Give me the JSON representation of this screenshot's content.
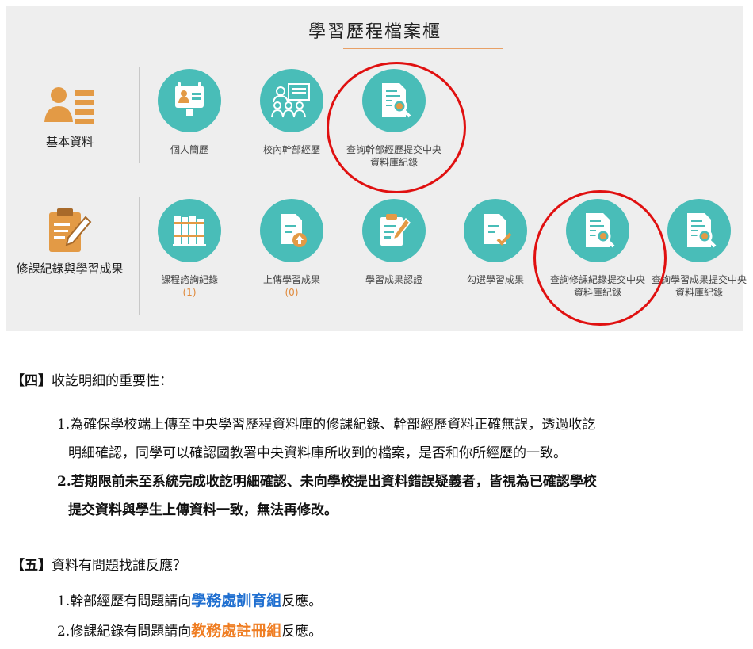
{
  "panel": {
    "title": "學習歷程檔案櫃",
    "accent": "#49bdb8",
    "basic": {
      "label": "基本資料",
      "icon": "profile-list-icon",
      "items": [
        {
          "label": "個人簡歷",
          "icon": "id-badge-icon"
        },
        {
          "label": "校內幹部經歷",
          "icon": "team-cadre-icon"
        },
        {
          "label": "查詢幹部經歷提交中央資料庫紀錄",
          "icon": "document-search-icon"
        }
      ]
    },
    "courses": {
      "label": "修課紀錄與學習成果",
      "icon": "clipboard-edit-icon",
      "items": [
        {
          "label": "課程諮詢紀錄",
          "count": "(1)",
          "icon": "books-icon"
        },
        {
          "label": "上傳學習成果",
          "count": "(0)",
          "icon": "file-upload-icon"
        },
        {
          "label": "學習成果認證",
          "icon": "clipboard-pencil-icon"
        },
        {
          "label": "勾選學習成果",
          "icon": "file-check-icon"
        },
        {
          "label": "查詢修課紀錄提交中央資料庫紀錄",
          "icon": "document-search-icon"
        },
        {
          "label": "查詢學習成果提交中央資料庫紀錄",
          "icon": "document-search-icon"
        }
      ]
    }
  },
  "section4": {
    "open": "【四】",
    "heading": "收訖明細的重要性：",
    "p1_num": "1.",
    "p1_line1": "為確保學校端上傳至中央學習歷程資料庫的修課紀錄、幹部經歷資料正確無誤，透過收訖",
    "p1_line2": "明細確認，同學可以確認國教署中央資料庫所收到的檔案，是否和你所經歷的一致。",
    "p2_num": "2.",
    "p2_line1": "若期限前未至系統完成收訖明細確認、未向學校提出資料錯誤疑義者，皆視為已確認學校",
    "p2_line2": "提交資料與學生上傳資料一致，無法再修改。"
  },
  "section5": {
    "open": "【五】",
    "heading": "資料有問題找誰反應？",
    "l1_pre": "1.幹部經歷有問題請向",
    "l1_hl": "學務處訓育組",
    "l1_post": "反應。",
    "l2_pre": "2.修課紀錄有問題請向",
    "l2_hl": "教務處註冊組",
    "l2_post": "反應。",
    "color_blue": "#1f6fd0",
    "color_orange": "#ef7d22"
  }
}
